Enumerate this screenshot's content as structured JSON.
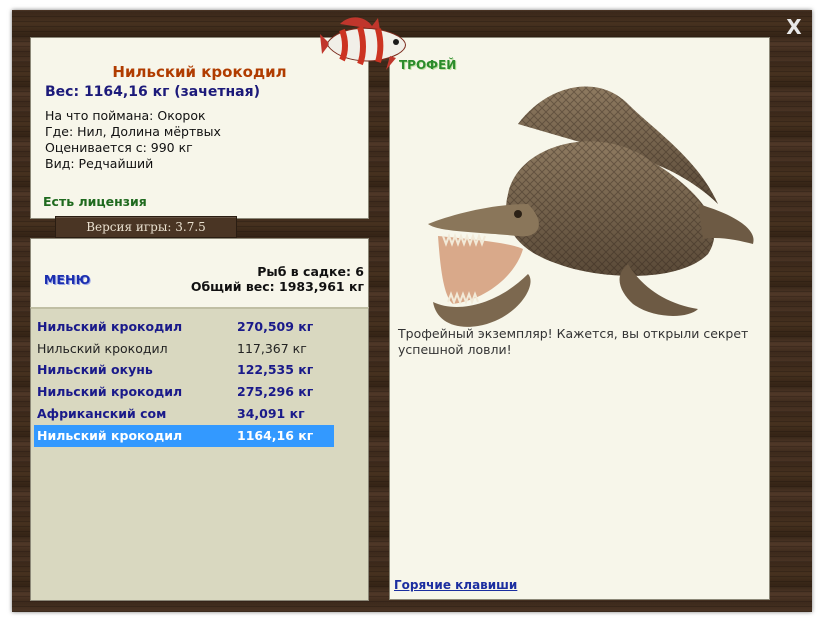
{
  "window": {
    "close_label": "X"
  },
  "catch": {
    "name": "Нильский крокодил",
    "weight": "Вес: 1164,16 кг (зачетная)",
    "bait": "На что поймана: Окорок",
    "location": "Где: Нил, Долина мёртвых",
    "value": "Оценивается с: 990 кг",
    "rarity": "Вид: Редчайший",
    "license": "Есть лицензия"
  },
  "version": "Версия игры: 3.7.5",
  "stats": {
    "menu_label": "МЕНЮ",
    "fish_count": "Рыб в садке: 6",
    "total_weight": "Общий вес: 1983,961 кг"
  },
  "list": [
    {
      "name": "Нильский крокодил",
      "weight": "270,509 кг",
      "style": "bold"
    },
    {
      "name": "Нильский крокодил",
      "weight": "117,367 кг",
      "style": "plain"
    },
    {
      "name": "Нильский окунь",
      "weight": "122,535 кг",
      "style": "bold"
    },
    {
      "name": "Нильский крокодил",
      "weight": "275,296 кг",
      "style": "bold"
    },
    {
      "name": "Африканский сом",
      "weight": "34,091 кг",
      "style": "bold"
    },
    {
      "name": "Нильский крокодил",
      "weight": "1164,16 кг",
      "style": "selected"
    }
  ],
  "trophy": {
    "label": "ТРОФЕЙ",
    "text": "Трофейный экземпляр! Кажется, вы открыли секрет успешной ловли!",
    "hotkeys": "Горячие клавиши"
  },
  "colors": {
    "fish_name": "#b03c00",
    "weight": "#1c1a7a",
    "license": "#1f6a1f",
    "selection": "#3399ff",
    "wood": "#3d2a1c",
    "panel": "#f7f6ea",
    "list_bg": "#d9d8c0"
  }
}
